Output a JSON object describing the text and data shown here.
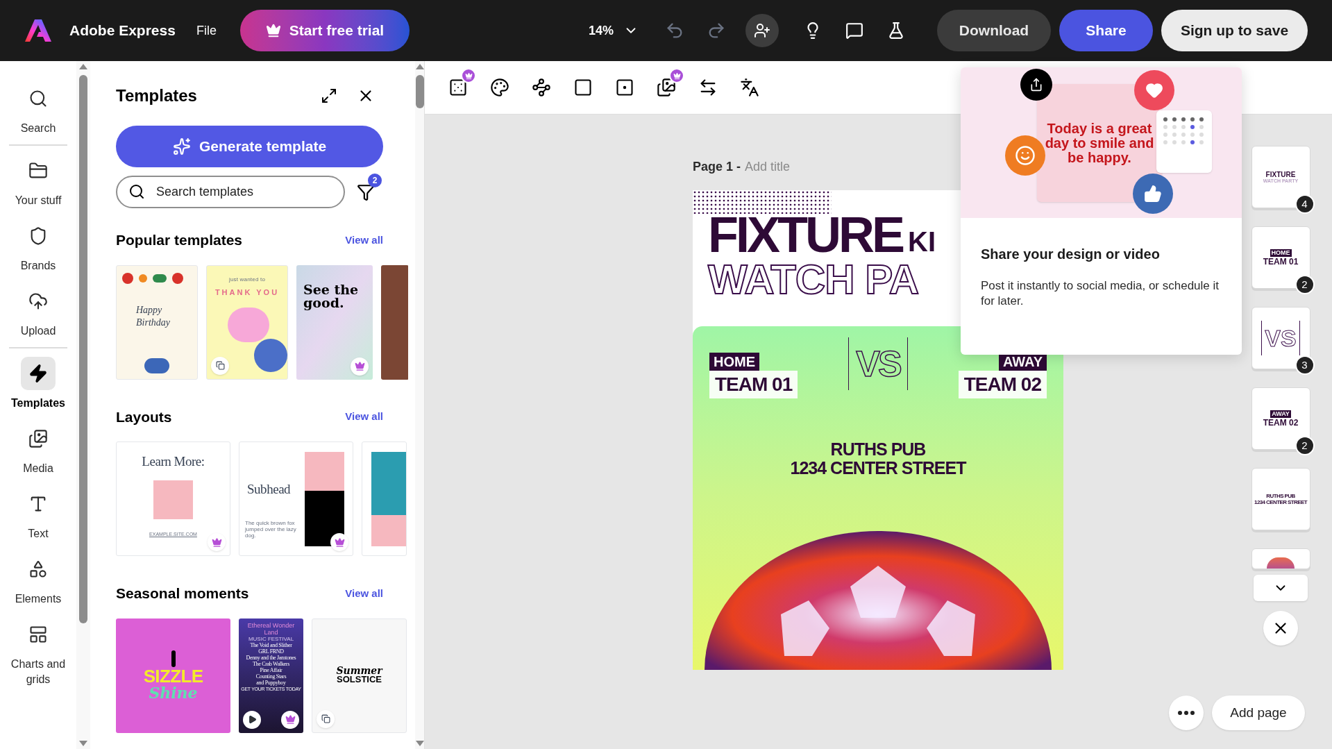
{
  "app": {
    "name": "Adobe Express",
    "menu": "File",
    "trial_button": "Start free trial"
  },
  "top_toolbar": {
    "zoom": "14%",
    "download": "Download",
    "share": "Share",
    "signup": "Sign up to save"
  },
  "rail": [
    {
      "label": "Search",
      "selected": false,
      "divider_after": true
    },
    {
      "label": "Your stuff",
      "selected": false,
      "divider_after": false
    },
    {
      "label": "Brands",
      "selected": false,
      "divider_after": false
    },
    {
      "label": "Upload",
      "selected": false,
      "divider_after": true
    },
    {
      "label": "Templates",
      "selected": true,
      "divider_after": false
    },
    {
      "label": "Media",
      "selected": false,
      "divider_after": false
    },
    {
      "label": "Text",
      "selected": false,
      "divider_after": false
    },
    {
      "label": "Elements",
      "selected": false,
      "divider_after": false
    },
    {
      "label": "Charts and grids",
      "selected": false,
      "divider_after": false
    }
  ],
  "panel": {
    "title": "Templates",
    "generate_button": "Generate template",
    "search": {
      "placeholder": "Search templates"
    },
    "filter_count": "2",
    "sections": [
      {
        "title": "Popular templates",
        "link": "View all",
        "cards": [
          {
            "kind": "birthday",
            "texts": [
              "Happy Birthday"
            ],
            "premium": false,
            "multi_page": false,
            "video": false
          },
          {
            "kind": "thankyou",
            "texts": [
              "just wanted to",
              "THANK YOU"
            ],
            "premium": false,
            "multi_page": true,
            "video": false
          },
          {
            "kind": "holo",
            "texts": [
              "See the good."
            ],
            "premium": true,
            "multi_page": false,
            "video": false
          },
          {
            "kind": "photo",
            "premium": false,
            "multi_page": false,
            "video": false
          }
        ]
      },
      {
        "title": "Layouts",
        "link": "View all",
        "cards": [
          {
            "kind": "learn",
            "texts": [
              "Learn More:",
              "EXAMPLE.SITE.COM"
            ],
            "premium": true,
            "multi_page": false,
            "video": false
          },
          {
            "kind": "subhead",
            "texts": [
              "Subhead",
              "The quick brown fox jumped over the lazy dog."
            ],
            "premium": true,
            "multi_page": false,
            "video": false
          },
          {
            "kind": "ocean",
            "premium": false,
            "multi_page": false,
            "video": false
          }
        ]
      },
      {
        "title": "Seasonal moments",
        "link": "View all",
        "cards": [
          {
            "kind": "sizzle",
            "texts": [
              "SIZZLE",
              "Shine"
            ],
            "premium": false,
            "multi_page": false,
            "video": false
          },
          {
            "kind": "festival",
            "texts": [
              "Ethereal Wonder Land",
              "MUSIC FESTIVAL",
              "The Void and Slither",
              "GRL FRND",
              "Denny and the Jamtones",
              "The Crab Walkers",
              "Pine Affair",
              "Counting Stars",
              "and Puppyboy",
              "GET YOUR TICKETS TODAY"
            ],
            "premium": true,
            "multi_page": false,
            "video": true
          },
          {
            "kind": "solstice",
            "texts": [
              "Summer",
              "SOLSTICE"
            ],
            "premium": false,
            "multi_page": true,
            "video": false
          }
        ]
      }
    ]
  },
  "canvas_tools": [
    {
      "premium": true
    },
    {
      "premium": false
    },
    {
      "premium": false
    },
    {
      "premium": false
    },
    {
      "premium": false
    },
    {
      "premium": true
    },
    {
      "premium": false
    },
    {
      "premium": false
    }
  ],
  "page": {
    "label": "Page 1 -",
    "title_placeholder": "Add title"
  },
  "design": {
    "headline": "FIXTURE",
    "headline_tail": "KI",
    "subheadline": "WATCH PA",
    "home_tag": "HOME",
    "home_team": "TEAM 01",
    "vs": "VS",
    "away_tag": "AWAY",
    "away_team": "TEAM 02",
    "venue": "RUTHS PUB",
    "address": "1234 CENTER STREET"
  },
  "popover": {
    "card_text": "Today is a great day to smile and be happy.",
    "title": "Share your design or video",
    "body": "Post it instantly to social media, or schedule it for later."
  },
  "thumbnails": [
    {
      "kind": "title",
      "texts": [
        "FIXTURE",
        "WATCH PARTY"
      ],
      "count": "4"
    },
    {
      "kind": "tag",
      "texts": [
        "HOME",
        "TEAM 01"
      ],
      "count": "2"
    },
    {
      "kind": "vs",
      "texts": [
        "VS"
      ],
      "count": "3"
    },
    {
      "kind": "tag",
      "texts": [
        "AWAY",
        "TEAM 02"
      ],
      "count": "2"
    },
    {
      "kind": "plain",
      "texts": [
        "RUTHS PUB",
        "1234 CENTER STREET"
      ]
    },
    {
      "kind": "ball"
    }
  ],
  "add_page": "Add page"
}
